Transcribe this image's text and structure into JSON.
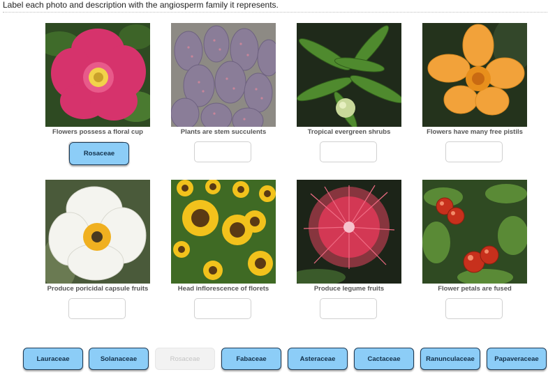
{
  "instructions": "Label each photo and description with the angiosperm family it represents.",
  "cards": [
    {
      "description": "Flowers possess a floral cup",
      "image": "rose-photo",
      "placed_label": "Rosaceae"
    },
    {
      "description": "Plants are stem succulents",
      "image": "prickly-pear-cactus-photo",
      "placed_label": ""
    },
    {
      "description": "Tropical evergreen shrubs",
      "image": "laurel-leaves-photo",
      "placed_label": ""
    },
    {
      "description": "Flowers have many free pistils",
      "image": "buttercup-photo",
      "placed_label": ""
    },
    {
      "description": "Produce poricidal capsule fruits",
      "image": "prickly-poppy-photo",
      "placed_label": ""
    },
    {
      "description": "Head inflorescence of florets",
      "image": "sunflowers-photo",
      "placed_label": ""
    },
    {
      "description": "Produce legume fruits",
      "image": "fairy-duster-photo",
      "placed_label": ""
    },
    {
      "description": "Flower petals are fused",
      "image": "tomato-plant-photo",
      "placed_label": ""
    }
  ],
  "bank": [
    {
      "label": "Lauraceae",
      "state": "available"
    },
    {
      "label": "Solanaceae",
      "state": "available"
    },
    {
      "label": "Rosaceae",
      "state": "used"
    },
    {
      "label": "Fabaceae",
      "state": "available"
    },
    {
      "label": "Asteraceae",
      "state": "available"
    },
    {
      "label": "Cactaceae",
      "state": "available"
    },
    {
      "label": "Ranunculaceae",
      "state": "available"
    },
    {
      "label": "Papaveraceae",
      "state": "available"
    }
  ],
  "colors": {
    "chip_fill": "#8ccdf7",
    "chip_border": "#1d3a55",
    "chip_disabled_fill": "#f2f2f2",
    "chip_disabled_text": "#c4c4c4"
  }
}
